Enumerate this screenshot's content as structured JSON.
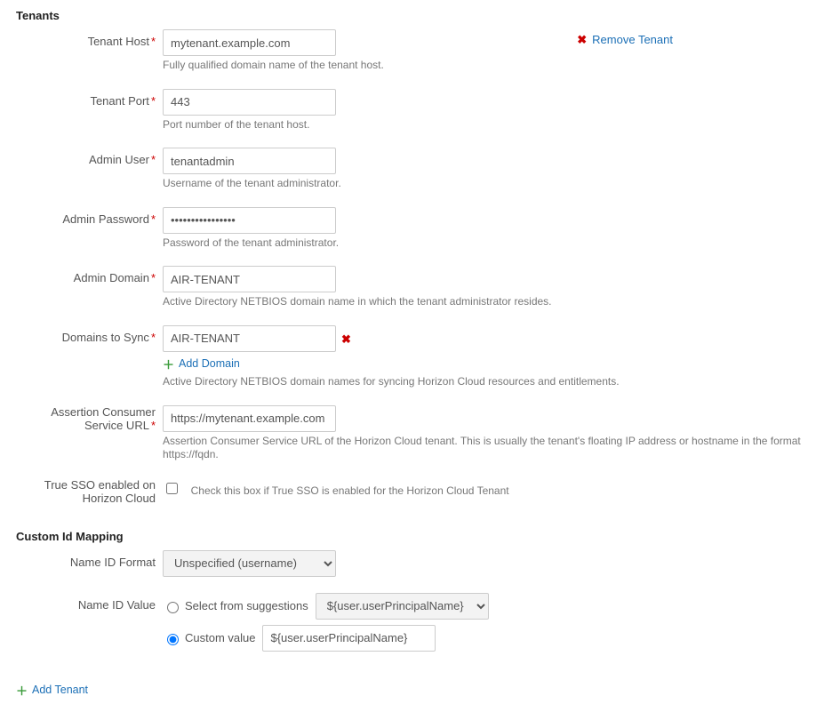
{
  "sections": {
    "tenants_title": "Tenants",
    "custom_id_title": "Custom Id Mapping"
  },
  "remove_tenant": "Remove Tenant",
  "tenant_host": {
    "label": "Tenant Host",
    "value": "mytenant.example.com",
    "help": "Fully qualified domain name of the tenant host."
  },
  "tenant_port": {
    "label": "Tenant Port",
    "value": "443",
    "help": "Port number of the tenant host."
  },
  "admin_user": {
    "label": "Admin User",
    "value": "tenantadmin",
    "help": "Username of the tenant administrator."
  },
  "admin_password": {
    "label": "Admin Password",
    "value": "••••••••••••••••",
    "help": "Password of the tenant administrator."
  },
  "admin_domain": {
    "label": "Admin Domain",
    "value": "AIR-TENANT",
    "help": "Active Directory NETBIOS domain name in which the tenant administrator resides."
  },
  "domains_sync": {
    "label": "Domains to Sync",
    "value": "AIR-TENANT",
    "add_label": "Add Domain",
    "help": "Active Directory NETBIOS domain names for syncing Horizon Cloud resources and entitlements."
  },
  "acs_url": {
    "label_line1": "Assertion Consumer",
    "label_line2": "Service URL",
    "value": "https://mytenant.example.com",
    "help": "Assertion Consumer Service URL of the Horizon Cloud tenant. This is usually the tenant's floating IP address or hostname in the format https://fqdn."
  },
  "true_sso": {
    "label_line1": "True SSO enabled on",
    "label_line2": "Horizon Cloud",
    "help": "Check this box if True SSO is enabled for the Horizon Cloud Tenant"
  },
  "name_id_format": {
    "label": "Name ID Format",
    "selected": "Unspecified (username)"
  },
  "name_id_value": {
    "label": "Name ID Value",
    "suggest_label": "Select from suggestions",
    "suggest_selected": "${user.userPrincipalName}",
    "custom_label": "Custom value",
    "custom_value": "${user.userPrincipalName}"
  },
  "add_tenant": "Add Tenant"
}
